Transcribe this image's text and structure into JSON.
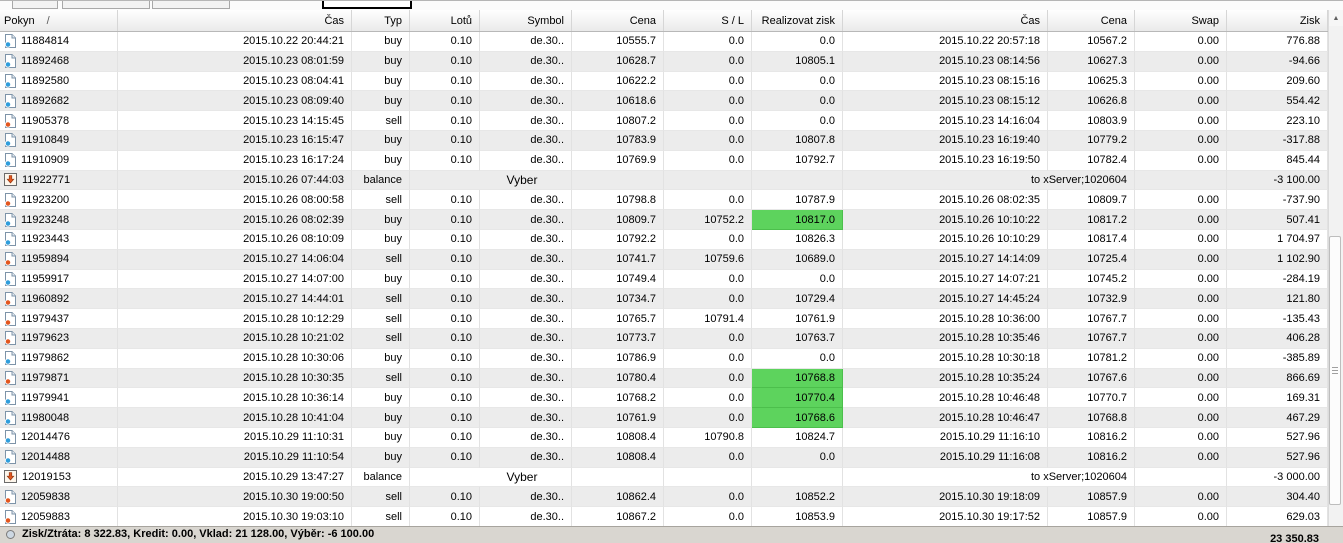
{
  "table": {
    "sort_indicator": "/",
    "columns": [
      {
        "label": "Pokyn"
      },
      {
        "label": "Čas"
      },
      {
        "label": "Typ"
      },
      {
        "label": "Lotů"
      },
      {
        "label": "Symbol"
      },
      {
        "label": "Cena"
      },
      {
        "label": "S / L"
      },
      {
        "label": "Realizovat zisk"
      },
      {
        "label": "Čas"
      },
      {
        "label": "Cena"
      },
      {
        "label": "Swap"
      },
      {
        "label": "Zisk"
      }
    ],
    "rows": [
      {
        "kind": "trade",
        "icon": "doc-buy-icon",
        "order": "11884814",
        "open_time": "2015.10.22 20:44:21",
        "type_label": "buy",
        "lots": "0.10",
        "symbol": "de.30..",
        "open_price": "10555.7",
        "sl": "0.0",
        "tp": "0.0",
        "tp_highlight": false,
        "close_time": "2015.10.22 20:57:18",
        "close_price": "10567.2",
        "swap": "0.00",
        "profit": "776.88"
      },
      {
        "kind": "trade",
        "icon": "doc-buy-icon",
        "order": "11892468",
        "open_time": "2015.10.23 08:01:59",
        "type_label": "buy",
        "lots": "0.10",
        "symbol": "de.30..",
        "open_price": "10628.7",
        "sl": "0.0",
        "tp": "10805.1",
        "tp_highlight": false,
        "close_time": "2015.10.23 08:14:56",
        "close_price": "10627.3",
        "swap": "0.00",
        "profit": "-94.66"
      },
      {
        "kind": "trade",
        "icon": "doc-buy-icon",
        "order": "11892580",
        "open_time": "2015.10.23 08:04:41",
        "type_label": "buy",
        "lots": "0.10",
        "symbol": "de.30..",
        "open_price": "10622.2",
        "sl": "0.0",
        "tp": "0.0",
        "tp_highlight": false,
        "close_time": "2015.10.23 08:15:16",
        "close_price": "10625.3",
        "swap": "0.00",
        "profit": "209.60"
      },
      {
        "kind": "trade",
        "icon": "doc-buy-icon",
        "order": "11892682",
        "open_time": "2015.10.23 08:09:40",
        "type_label": "buy",
        "lots": "0.10",
        "symbol": "de.30..",
        "open_price": "10618.6",
        "sl": "0.0",
        "tp": "0.0",
        "tp_highlight": false,
        "close_time": "2015.10.23 08:15:12",
        "close_price": "10626.8",
        "swap": "0.00",
        "profit": "554.42"
      },
      {
        "kind": "trade",
        "icon": "doc-sell-icon",
        "order": "11905378",
        "open_time": "2015.10.23 14:15:45",
        "type_label": "sell",
        "lots": "0.10",
        "symbol": "de.30..",
        "open_price": "10807.2",
        "sl": "0.0",
        "tp": "0.0",
        "tp_highlight": false,
        "close_time": "2015.10.23 14:16:04",
        "close_price": "10803.9",
        "swap": "0.00",
        "profit": "223.10"
      },
      {
        "kind": "trade",
        "icon": "doc-buy-icon",
        "order": "11910849",
        "open_time": "2015.10.23 16:15:47",
        "type_label": "buy",
        "lots": "0.10",
        "symbol": "de.30..",
        "open_price": "10783.9",
        "sl": "0.0",
        "tp": "10807.8",
        "tp_highlight": false,
        "close_time": "2015.10.23 16:19:40",
        "close_price": "10779.2",
        "swap": "0.00",
        "profit": "-317.88"
      },
      {
        "kind": "trade",
        "icon": "doc-buy-icon",
        "order": "11910909",
        "open_time": "2015.10.23 16:17:24",
        "type_label": "buy",
        "lots": "0.10",
        "symbol": "de.30..",
        "open_price": "10769.9",
        "sl": "0.0",
        "tp": "10792.7",
        "tp_highlight": false,
        "close_time": "2015.10.23 16:19:50",
        "close_price": "10782.4",
        "swap": "0.00",
        "profit": "845.44"
      },
      {
        "kind": "balance",
        "icon": "balance-arrow-icon",
        "order": "11922771",
        "open_time": "2015.10.26 07:44:03",
        "type_label": "balance",
        "label": "Vyber",
        "comment": "to xServer;1020604",
        "profit": "-3 100.00"
      },
      {
        "kind": "trade",
        "icon": "doc-sell-icon",
        "order": "11923200",
        "open_time": "2015.10.26 08:00:58",
        "type_label": "sell",
        "lots": "0.10",
        "symbol": "de.30..",
        "open_price": "10798.8",
        "sl": "0.0",
        "tp": "10787.9",
        "tp_highlight": false,
        "close_time": "2015.10.26 08:02:35",
        "close_price": "10809.7",
        "swap": "0.00",
        "profit": "-737.90"
      },
      {
        "kind": "trade",
        "icon": "doc-buy-icon",
        "order": "11923248",
        "open_time": "2015.10.26 08:02:39",
        "type_label": "buy",
        "lots": "0.10",
        "symbol": "de.30..",
        "open_price": "10809.7",
        "sl": "10752.2",
        "tp": "10817.0",
        "tp_highlight": true,
        "close_time": "2015.10.26 10:10:22",
        "close_price": "10817.2",
        "swap": "0.00",
        "profit": "507.41"
      },
      {
        "kind": "trade",
        "icon": "doc-buy-icon",
        "order": "11923443",
        "open_time": "2015.10.26 08:10:09",
        "type_label": "buy",
        "lots": "0.10",
        "symbol": "de.30..",
        "open_price": "10792.2",
        "sl": "0.0",
        "tp": "10826.3",
        "tp_highlight": false,
        "close_time": "2015.10.26 10:10:29",
        "close_price": "10817.4",
        "swap": "0.00",
        "profit": "1 704.97"
      },
      {
        "kind": "trade",
        "icon": "doc-sell-icon",
        "order": "11959894",
        "open_time": "2015.10.27 14:06:04",
        "type_label": "sell",
        "lots": "0.10",
        "symbol": "de.30..",
        "open_price": "10741.7",
        "sl": "10759.6",
        "tp": "10689.0",
        "tp_highlight": false,
        "close_time": "2015.10.27 14:14:09",
        "close_price": "10725.4",
        "swap": "0.00",
        "profit": "1 102.90"
      },
      {
        "kind": "trade",
        "icon": "doc-buy-icon",
        "order": "11959917",
        "open_time": "2015.10.27 14:07:00",
        "type_label": "buy",
        "lots": "0.10",
        "symbol": "de.30..",
        "open_price": "10749.4",
        "sl": "0.0",
        "tp": "0.0",
        "tp_highlight": false,
        "close_time": "2015.10.27 14:07:21",
        "close_price": "10745.2",
        "swap": "0.00",
        "profit": "-284.19"
      },
      {
        "kind": "trade",
        "icon": "doc-sell-icon",
        "order": "11960892",
        "open_time": "2015.10.27 14:44:01",
        "type_label": "sell",
        "lots": "0.10",
        "symbol": "de.30..",
        "open_price": "10734.7",
        "sl": "0.0",
        "tp": "10729.4",
        "tp_highlight": false,
        "close_time": "2015.10.27 14:45:24",
        "close_price": "10732.9",
        "swap": "0.00",
        "profit": "121.80"
      },
      {
        "kind": "trade",
        "icon": "doc-sell-icon",
        "order": "11979437",
        "open_time": "2015.10.28 10:12:29",
        "type_label": "sell",
        "lots": "0.10",
        "symbol": "de.30..",
        "open_price": "10765.7",
        "sl": "10791.4",
        "tp": "10761.9",
        "tp_highlight": false,
        "close_time": "2015.10.28 10:36:00",
        "close_price": "10767.7",
        "swap": "0.00",
        "profit": "-135.43"
      },
      {
        "kind": "trade",
        "icon": "doc-sell-icon",
        "order": "11979623",
        "open_time": "2015.10.28 10:21:02",
        "type_label": "sell",
        "lots": "0.10",
        "symbol": "de.30..",
        "open_price": "10773.7",
        "sl": "0.0",
        "tp": "10763.7",
        "tp_highlight": false,
        "close_time": "2015.10.28 10:35:46",
        "close_price": "10767.7",
        "swap": "0.00",
        "profit": "406.28"
      },
      {
        "kind": "trade",
        "icon": "doc-buy-icon",
        "order": "11979862",
        "open_time": "2015.10.28 10:30:06",
        "type_label": "buy",
        "lots": "0.10",
        "symbol": "de.30..",
        "open_price": "10786.9",
        "sl": "0.0",
        "tp": "0.0",
        "tp_highlight": false,
        "close_time": "2015.10.28 10:30:18",
        "close_price": "10781.2",
        "swap": "0.00",
        "profit": "-385.89"
      },
      {
        "kind": "trade",
        "icon": "doc-sell-icon",
        "order": "11979871",
        "open_time": "2015.10.28 10:30:35",
        "type_label": "sell",
        "lots": "0.10",
        "symbol": "de.30..",
        "open_price": "10780.4",
        "sl": "0.0",
        "tp": "10768.8",
        "tp_highlight": true,
        "close_time": "2015.10.28 10:35:24",
        "close_price": "10767.6",
        "swap": "0.00",
        "profit": "866.69"
      },
      {
        "kind": "trade",
        "icon": "doc-buy-icon",
        "order": "11979941",
        "open_time": "2015.10.28 10:36:14",
        "type_label": "buy",
        "lots": "0.10",
        "symbol": "de.30..",
        "open_price": "10768.2",
        "sl": "0.0",
        "tp": "10770.4",
        "tp_highlight": true,
        "close_time": "2015.10.28 10:46:48",
        "close_price": "10770.7",
        "swap": "0.00",
        "profit": "169.31"
      },
      {
        "kind": "trade",
        "icon": "doc-buy-icon",
        "order": "11980048",
        "open_time": "2015.10.28 10:41:04",
        "type_label": "buy",
        "lots": "0.10",
        "symbol": "de.30..",
        "open_price": "10761.9",
        "sl": "0.0",
        "tp": "10768.6",
        "tp_highlight": true,
        "close_time": "2015.10.28 10:46:47",
        "close_price": "10768.8",
        "swap": "0.00",
        "profit": "467.29"
      },
      {
        "kind": "trade",
        "icon": "doc-buy-icon",
        "order": "12014476",
        "open_time": "2015.10.29 11:10:31",
        "type_label": "buy",
        "lots": "0.10",
        "symbol": "de.30..",
        "open_price": "10808.4",
        "sl": "10790.8",
        "tp": "10824.7",
        "tp_highlight": false,
        "close_time": "2015.10.29 11:16:10",
        "close_price": "10816.2",
        "swap": "0.00",
        "profit": "527.96"
      },
      {
        "kind": "trade",
        "icon": "doc-buy-icon",
        "order": "12014488",
        "open_time": "2015.10.29 11:10:54",
        "type_label": "buy",
        "lots": "0.10",
        "symbol": "de.30..",
        "open_price": "10808.4",
        "sl": "0.0",
        "tp": "0.0",
        "tp_highlight": false,
        "close_time": "2015.10.29 11:16:08",
        "close_price": "10816.2",
        "swap": "0.00",
        "profit": "527.96"
      },
      {
        "kind": "balance",
        "icon": "balance-arrow-icon",
        "order": "12019153",
        "open_time": "2015.10.29 13:47:27",
        "type_label": "balance",
        "label": "Vyber",
        "comment": "to xServer;1020604",
        "profit": "-3 000.00"
      },
      {
        "kind": "trade",
        "icon": "doc-sell-icon",
        "order": "12059838",
        "open_time": "2015.10.30 19:00:50",
        "type_label": "sell",
        "lots": "0.10",
        "symbol": "de.30..",
        "open_price": "10862.4",
        "sl": "0.0",
        "tp": "10852.2",
        "tp_highlight": false,
        "close_time": "2015.10.30 19:18:09",
        "close_price": "10857.9",
        "swap": "0.00",
        "profit": "304.40"
      },
      {
        "kind": "trade",
        "icon": "doc-sell-icon",
        "order": "12059883",
        "open_time": "2015.10.30 19:03:10",
        "type_label": "sell",
        "lots": "0.10",
        "symbol": "de.30..",
        "open_price": "10867.2",
        "sl": "0.0",
        "tp": "10853.9",
        "tp_highlight": false,
        "close_time": "2015.10.30 19:17:52",
        "close_price": "10857.9",
        "swap": "0.00",
        "profit": "629.03"
      }
    ]
  },
  "status": {
    "summary": "Zisk/Ztráta: 8 322.83, Kredit: 0.00, Vklad: 21 128.00, Výběr: -6 100.00",
    "total": "23 350.83"
  },
  "colors": {
    "tp_highlight_green": "#5dd35d",
    "buy_dot": "#2f9ddb",
    "sell_dot": "#e2561f",
    "balance_arrow": "#e2561f"
  },
  "scrollbar": {
    "up_arrow": "▲"
  }
}
